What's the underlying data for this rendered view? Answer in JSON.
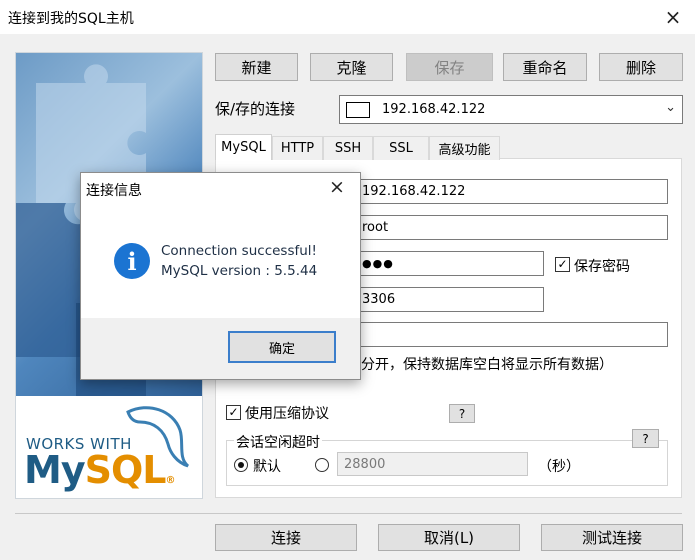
{
  "window": {
    "title": "连接到我的SQL主机",
    "close_glyph": "×"
  },
  "brand": {
    "works_with": "WORKS WITH",
    "my": "My",
    "sql": "SQL",
    "reg": "®"
  },
  "toolbar": {
    "new_label": "新建",
    "clone_label": "克隆",
    "save_label": "保存",
    "rename_label": "重命名",
    "delete_label": "删除"
  },
  "saved_connection": {
    "label": "保/存的连接",
    "value": "192.168.42.122"
  },
  "tabs": [
    {
      "label": "MySQL"
    },
    {
      "label": "HTTP"
    },
    {
      "label": "SSH"
    },
    {
      "label": "SSL"
    },
    {
      "label": "高级功能"
    }
  ],
  "form": {
    "host_value": "192.168.42.122",
    "user_value": "root",
    "password_mask": "●●●",
    "save_password_label": "保存密码",
    "save_password_checked": true,
    "port_value": "3306",
    "database_value": "",
    "database_hint": "分开，保持数据库空白将显示所有数据）",
    "compress_label": "使用压缩协议",
    "compress_checked": true,
    "help_glyph": "?",
    "session_timeout_label": "会话空闲超时",
    "default_label": "默认",
    "timeout_value": "28800",
    "seconds_label": "（秒）"
  },
  "footer": {
    "connect_label": "连接",
    "cancel_label": "取消(L)",
    "test_label": "测试连接"
  },
  "dialog": {
    "title": "连接信息",
    "close_glyph": "×",
    "icon_glyph": "i",
    "message_line1": "Connection successful!",
    "message_line2": "MySQL version : 5.5.44",
    "ok_label": "确定"
  },
  "colors": {
    "info_blue": "#1b74d2",
    "mysql_blue": "#1f5c85",
    "mysql_orange": "#e48e00"
  }
}
